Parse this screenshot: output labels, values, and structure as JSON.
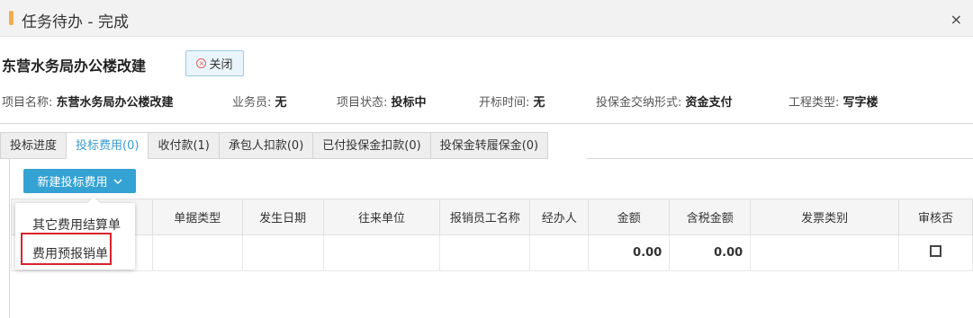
{
  "dialog": {
    "title": "任务待办 - 完成",
    "close_glyph": "×"
  },
  "project": {
    "name": "东营水务局办公楼改建",
    "close_button_label": "关闭"
  },
  "info": [
    {
      "label": "项目名称: ",
      "value": "东营水务局办公楼改建"
    },
    {
      "label": "业务员: ",
      "value": "无"
    },
    {
      "label": "项目状态: ",
      "value": "投标中"
    },
    {
      "label": "开标时间: ",
      "value": "无"
    },
    {
      "label": "投保金交纳形式: ",
      "value": "资金支付"
    },
    {
      "label": "工程类型: ",
      "value": "写字楼"
    }
  ],
  "tabs": [
    "投标进度",
    "投标费用(0)",
    "收付款(1)",
    "承包人扣款(0)",
    "已付投保金扣款(0)",
    "投保金转履保金(0)"
  ],
  "toolbar": {
    "new_button_label": "新建投标费用"
  },
  "dropdown": {
    "items": [
      "其它费用结算单",
      "费用预报销单"
    ]
  },
  "table": {
    "headers": [
      "",
      "单据类型",
      "发生日期",
      "往来单位",
      "报销员工名称",
      "经办人",
      "金额",
      "含税金额",
      "发票类别",
      "审核否"
    ],
    "row": {
      "amount": "0.00",
      "tax_amount": "0.00"
    }
  },
  "colors": {
    "accent": "#f0ad4e",
    "primary": "#35a2d4",
    "highlight": "#d9232d"
  }
}
